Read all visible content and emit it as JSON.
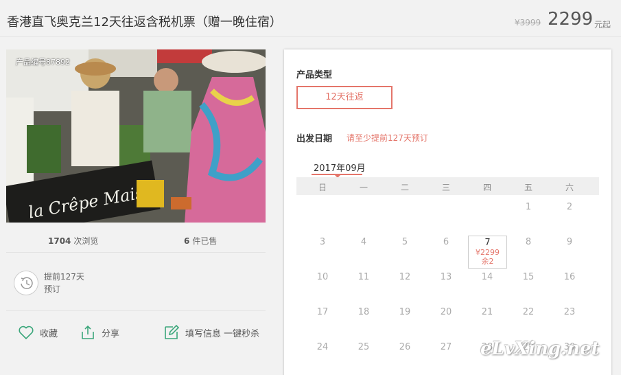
{
  "header": {
    "title": "香港直飞奥克兰12天往返含税机票（赠一晚住宿）",
    "old_price": "¥3999",
    "price": "2299",
    "price_suffix": "元起"
  },
  "product": {
    "number_label": "产品编号87892",
    "image_sign_text": "la Crêpe Maison"
  },
  "stats": {
    "views_count": "1704",
    "views_label": "次浏览",
    "sold_count": "6",
    "sold_label": "件已售"
  },
  "advance": {
    "line1": "提前127天",
    "line2": "预订"
  },
  "actions": {
    "favorite": "收藏",
    "share": "分享",
    "fill_info": "填写信息 一键秒杀"
  },
  "booking": {
    "product_type_label": "产品类型",
    "product_type_option": "12天往返",
    "departure_label": "出发日期",
    "departure_note": "请至少提前127天预订",
    "month": "2017年09月",
    "weekdays": [
      "日",
      "一",
      "二",
      "三",
      "四",
      "五",
      "六"
    ],
    "weeks": [
      [
        "",
        "",
        "",
        "",
        "",
        "1",
        "2"
      ],
      [
        "3",
        "4",
        "5",
        "6",
        "7",
        "8",
        "9"
      ],
      [
        "10",
        "11",
        "12",
        "13",
        "14",
        "15",
        "16"
      ],
      [
        "17",
        "18",
        "19",
        "20",
        "21",
        "22",
        "23"
      ],
      [
        "24",
        "25",
        "26",
        "27",
        "28",
        "29",
        "30"
      ]
    ],
    "selected_day": {
      "day": "7",
      "price": "¥2299",
      "remaining": "余2"
    }
  },
  "watermark": "eLvXing.net",
  "colors": {
    "accent": "#e4756a",
    "icon_green": "#3aa67a"
  }
}
